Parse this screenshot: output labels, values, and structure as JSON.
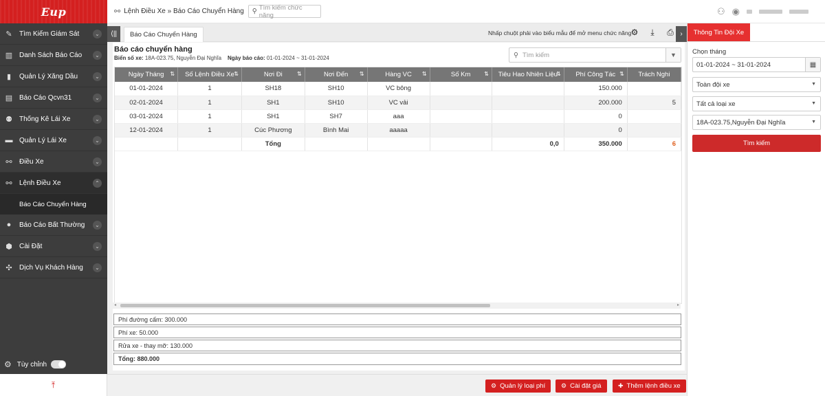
{
  "sidebar": {
    "logo": "Eup",
    "items": [
      {
        "label": "Tìm Kiếm Giám Sát",
        "icon": "route-icon"
      },
      {
        "label": "Danh Sách Báo Cáo",
        "icon": "bar-chart-icon"
      },
      {
        "label": "Quản Lý Xăng Dầu",
        "icon": "fuel-icon"
      },
      {
        "label": "Báo Cáo Qcvn31",
        "icon": "report-icon"
      },
      {
        "label": "Thống Kê Lái Xe",
        "icon": "driver-icon"
      },
      {
        "label": "Quản Lý Lái Xe",
        "icon": "briefcase-icon"
      },
      {
        "label": "Điều Xe",
        "icon": "dispatch-icon"
      },
      {
        "label": "Lệnh Điều Xe",
        "icon": "dispatch-order-icon"
      },
      {
        "label": "Báo Cáo Bất Thường",
        "icon": "alert-icon"
      },
      {
        "label": "Cài Đặt",
        "icon": "settings-icon"
      },
      {
        "label": "Dịch Vụ Khách Hàng",
        "icon": "grid-icon"
      }
    ],
    "sub_item": "Báo Cáo Chuyển Hàng",
    "custom_label": "Tùy chỉnh"
  },
  "topbar": {
    "breadcrumb": "Lệnh Điều Xe » Báo Cáo Chuyển Hàng",
    "search_placeholder": "Tìm kiếm chức năng"
  },
  "tabs": {
    "active": "Báo Cáo Chuyển Hàng",
    "hint": "Nhấp chuột phải vào biểu mẫu để mở menu chức năng"
  },
  "report": {
    "title": "Báo cáo chuyển hàng",
    "plate_label": "Biển số xe:",
    "plate_value": "18A-023.75, Nguyễn Đại Nghĩa",
    "date_label": "Ngày báo cáo:",
    "date_value": "01-01-2024 ~ 31-01-2024",
    "search_placeholder": "Tìm kiếm"
  },
  "table": {
    "headers": [
      "Ngày Tháng",
      "Số Lệnh Điều Xe",
      "Nơi Đi",
      "Nơi Đến",
      "Hàng VC",
      "Số Km",
      "Tiêu Hao Nhiên Liệu",
      "Phí Công Tác",
      "Trách Nghi"
    ],
    "rows": [
      [
        "01-01-2024",
        "1",
        "SH18",
        "SH10",
        "VC bông",
        "",
        "",
        "150.000",
        ""
      ],
      [
        "02-01-2024",
        "1",
        "SH1",
        "SH10",
        "VC vải",
        "",
        "",
        "200.000",
        "5"
      ],
      [
        "03-01-2024",
        "1",
        "SH1",
        "SH7",
        "aaa",
        "",
        "",
        "0",
        ""
      ],
      [
        "12-01-2024",
        "1",
        "Cúc Phương",
        "Bình Mai",
        "aaaaa",
        "",
        "",
        "0",
        ""
      ]
    ],
    "total_row": [
      "",
      "",
      "Tổng",
      "",
      "",
      "",
      "0,0",
      "350.000",
      "6"
    ]
  },
  "fees": {
    "items": [
      "Phí đường cấm: 300.000",
      "Phí xe: 50.000",
      "Rửa xe - thay mỡ: 130.000"
    ],
    "total": "Tổng: 880.000"
  },
  "buttons": {
    "fee_manage": "Quản lý loại phí",
    "price_setting": "Cài đặt giá",
    "add_order": "Thêm lệnh điều xe"
  },
  "right_panel": {
    "tab": "Thông Tin Đội Xe",
    "month_label": "Chọn tháng",
    "date_range": "01-01-2024 ~ 31-01-2024",
    "fleet": "Toàn đội xe",
    "vehicle_type": "Tất cả loại xe",
    "vehicle": "18A-023.75,Nguyễn Đại Nghĩa",
    "search_button": "Tìm kiếm"
  },
  "colors": {
    "brand": "#d42020",
    "sidebar_bg": "#3d3d3d",
    "table_header": "#767676"
  }
}
